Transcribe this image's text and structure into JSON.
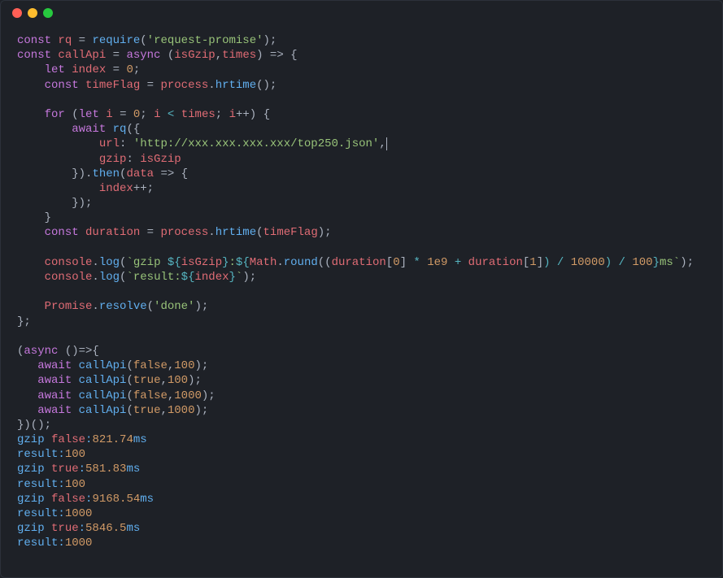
{
  "code": {
    "l1": {
      "kw1": "const",
      "v1": "rq",
      "eq": " = ",
      "fn": "require",
      "paren": "(",
      "str": "'request-promise'",
      "end": ");"
    },
    "l2": {
      "kw1": "const",
      "v1": "callApi",
      "eq": " = ",
      "kw2": "async",
      "paren": " (",
      "a1": "isGzip",
      "c1": ",",
      "a2": "times",
      "end": ") => {"
    },
    "l3": {
      "kw1": "let",
      "v1": "index",
      "eq": " = ",
      "num": "0",
      "end": ";"
    },
    "l4": {
      "kw1": "const",
      "v1": "timeFlag",
      "eq": " = ",
      "o": "process",
      "dot": ".",
      "fn": "hrtime",
      "end": "();"
    },
    "l6": {
      "kw1": "for",
      "p1": " (",
      "kw2": "let",
      "v1": "i",
      "eq": " = ",
      "num": "0",
      "semi1": "; ",
      "v2": "i",
      "op": " < ",
      "v3": "times",
      "semi2": "; ",
      "v4": "i",
      "inc": "++",
      "end": ") {"
    },
    "l7": {
      "kw": "await",
      "fn": "rq",
      "end": "({"
    },
    "l8": {
      "prop": "url",
      "c": ": ",
      "str": "'http://xxx.xxx.xxx.xxx/top250.json'",
      "end": ","
    },
    "l9": {
      "prop": "gzip",
      "c": ": ",
      "v": "isGzip"
    },
    "l10": {
      "p1": "}).",
      "fn": "then",
      "p2": "(",
      "arg": "data",
      "arr": " => {"
    },
    "l11": {
      "v": "index",
      "inc": "++",
      "end": ";"
    },
    "l12": {
      "end": "});"
    },
    "l13": {
      "end": "}"
    },
    "l14": {
      "kw": "const",
      "v": "duration",
      "eq": " = ",
      "o": "process",
      "dot": ".",
      "fn": "hrtime",
      "p": "(",
      "arg": "timeFlag",
      "end": ");"
    },
    "l16a": {
      "o": "console",
      "dot": ".",
      "fn": "log",
      "p": "(",
      "bt": "`",
      "t1": "gzip ",
      "d1": "${",
      "v1": "isGzip",
      "d2": "}",
      "t2": ":",
      "d3": "${",
      "m": "Math",
      "dot2": ".",
      "fn2": "round",
      "p2": "((",
      "v2": "duration",
      "br1": "[",
      "n0": "0",
      "br2": "]",
      "t3": " * ",
      "n1": "1e9",
      "t4": " + ",
      "v3": "duration",
      "br3": "[",
      "n2": "1",
      "br4": "]",
      "t5": ") / ",
      "n3": "10000",
      "t6": ") / ",
      "n4": "100",
      "d4": "}",
      "t7": "ms",
      "bt2": "`",
      "end": ");"
    },
    "l17": {
      "o": "console",
      "dot": ".",
      "fn": "log",
      "p": "(",
      "bt": "`",
      "t1": "result:",
      "d1": "${",
      "v": "index",
      "d2": "}",
      "bt2": "`",
      "end": ");"
    },
    "l19": {
      "o": "Promise",
      "dot": ".",
      "fn": "resolve",
      "p": "(",
      "str": "'done'",
      "end": ");"
    },
    "l20": {
      "end": "};"
    },
    "l22": {
      "p1": "(",
      "kw": "async",
      "p2": " ()=>{"
    },
    "l23": {
      "kw": "await",
      "fn": "callApi",
      "p": "(",
      "b": "false",
      "c": ",",
      "n": "100",
      "end": ");"
    },
    "l24": {
      "kw": "await",
      "fn": "callApi",
      "p": "(",
      "b": "true",
      "c": ",",
      "n": "100",
      "end": ");"
    },
    "l25": {
      "kw": "await",
      "fn": "callApi",
      "p": "(",
      "b": "false",
      "c": ",",
      "n": "1000",
      "end": ");"
    },
    "l26": {
      "kw": "await",
      "fn": "callApi",
      "p": "(",
      "b": "true",
      "c": ",",
      "n": "1000",
      "end": ");"
    },
    "l27": {
      "end": "})();"
    }
  },
  "output": {
    "o1": {
      "t1": "gzip ",
      "b": "false",
      "t2": ":",
      "n": "821.74",
      "t3": "ms"
    },
    "o2": {
      "t1": "result:",
      "n": "100"
    },
    "o3": {
      "t1": "gzip ",
      "b": "true",
      "t2": ":",
      "n": "581.83",
      "t3": "ms"
    },
    "o4": {
      "t1": "result:",
      "n": "100"
    },
    "o5": {
      "t1": "gzip ",
      "b": "false",
      "t2": ":",
      "n": "9168.54",
      "t3": "ms"
    },
    "o6": {
      "t1": "result:",
      "n": "1000"
    },
    "o7": {
      "t1": "gzip ",
      "b": "true",
      "t2": ":",
      "n": "5846.5",
      "t3": "ms"
    },
    "o8": {
      "t1": "result:",
      "n": "1000"
    }
  }
}
